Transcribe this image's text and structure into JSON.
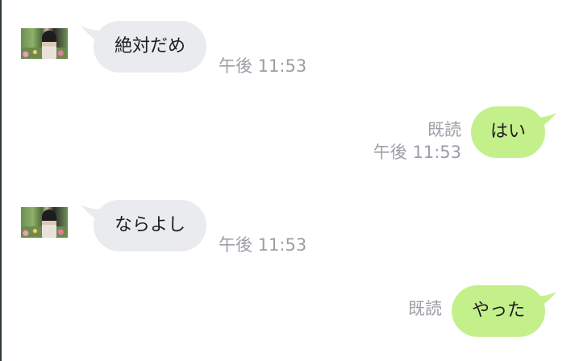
{
  "colors": {
    "incoming_bubble": "#e9ebee",
    "outgoing_bubble": "#c4f08c",
    "meta_text": "#9a9ea5",
    "message_text": "#1e1e1e"
  },
  "messages": [
    {
      "direction": "incoming",
      "text": "絶対だめ",
      "time": "午後 11:53",
      "read": ""
    },
    {
      "direction": "outgoing",
      "text": "はい",
      "time": "午後 11:53",
      "read": "既読"
    },
    {
      "direction": "incoming",
      "text": "ならよし",
      "time": "午後 11:53",
      "read": ""
    },
    {
      "direction": "outgoing",
      "text": "やった",
      "time": "",
      "read": "既読"
    }
  ]
}
